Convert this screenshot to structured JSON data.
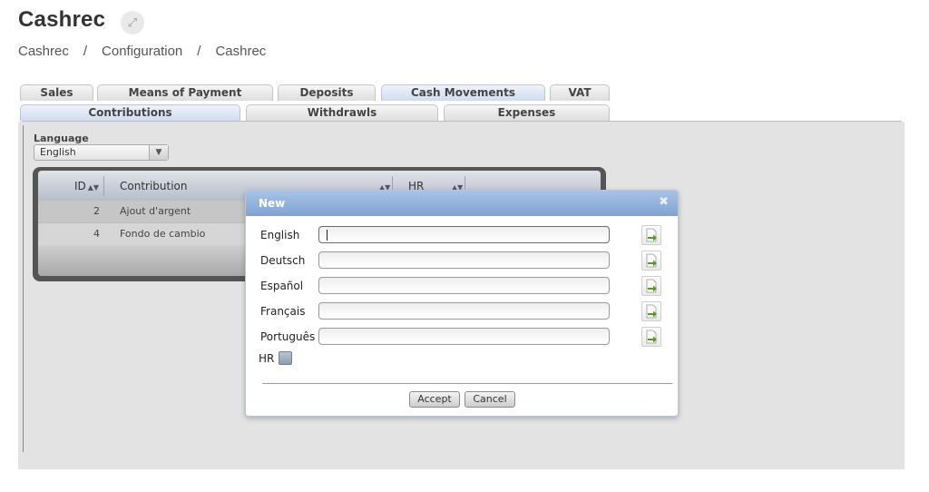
{
  "page": {
    "title": "Cashrec",
    "breadcrumb": [
      "Cashrec",
      "Configuration",
      "Cashrec"
    ],
    "breadcrumb_separator": "/"
  },
  "tabs": {
    "row1": [
      {
        "label": "Sales",
        "active": false
      },
      {
        "label": "Means of Payment",
        "active": false
      },
      {
        "label": "Deposits",
        "active": false
      },
      {
        "label": "Cash Movements",
        "active": true
      },
      {
        "label": "VAT",
        "active": false
      }
    ],
    "row2": [
      {
        "label": "Contributions",
        "active": true
      },
      {
        "label": "Withdrawls",
        "active": false
      },
      {
        "label": "Expenses",
        "active": false
      }
    ]
  },
  "language": {
    "label": "Language",
    "selected": "English"
  },
  "grid": {
    "columns": [
      "ID",
      "Contribution",
      "HR"
    ],
    "rows": [
      {
        "id": "2",
        "contribution": "Ajout d'argent"
      },
      {
        "id": "4",
        "contribution": "Fondo de cambio"
      }
    ]
  },
  "dialog": {
    "title": "New",
    "close_glyph": "✖",
    "fields": [
      {
        "label": "English",
        "value": ""
      },
      {
        "label": "Deutsch",
        "value": ""
      },
      {
        "label": "Español",
        "value": ""
      },
      {
        "label": "Français",
        "value": ""
      },
      {
        "label": "Português",
        "value": ""
      }
    ],
    "checkbox_label": "HR",
    "checkbox_checked": false,
    "accept_label": "Accept",
    "cancel_label": "Cancel"
  },
  "icons": {
    "expand": "expand-icon",
    "translate": "translate-icon",
    "dropdown": "chevron-down-icon",
    "sort": "sort-icon",
    "close": "close-icon"
  },
  "colors": {
    "dialog_header": "#7ea3d3",
    "active_tab": "#cfdcef",
    "panel_bg": "#e3e3e3",
    "grid_frame": "#555555",
    "translate_arrow": "#5a9a2a"
  }
}
